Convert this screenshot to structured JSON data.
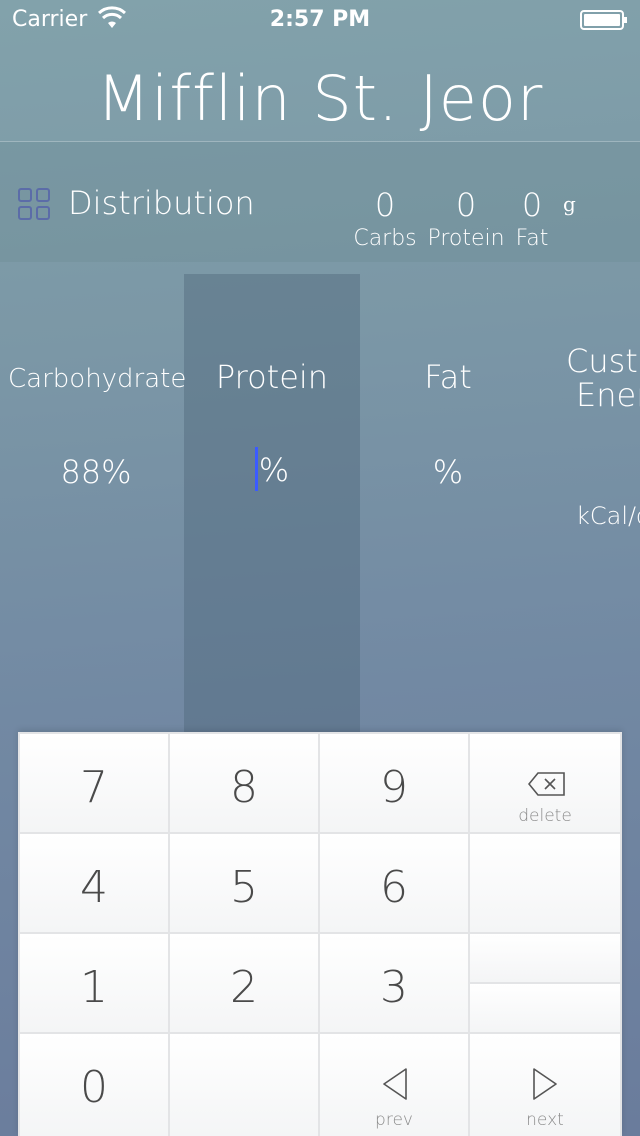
{
  "status_bar": {
    "carrier": "Carrier",
    "time": "2:57 PM"
  },
  "title": "Mifflin St. Jeor",
  "distribution": {
    "label": "Distribution",
    "icon": "grid-icon",
    "carbs_value": "0",
    "carbs_label": "Carbs",
    "protein_value": "0",
    "protein_label": "Protein",
    "fat_value": "0",
    "fat_label": "Fat",
    "unit": "g"
  },
  "columns": {
    "carbohydrate": {
      "title": "Carbohydrate",
      "value": "88%"
    },
    "protein": {
      "title": "Protein",
      "value": "%"
    },
    "fat": {
      "title": "Fat",
      "value": "%"
    },
    "custom_energy": {
      "title_line1": "Custo",
      "title_line2": "Ener",
      "value": "kCal/c"
    }
  },
  "keypad": {
    "keys": [
      "7",
      "8",
      "9",
      "4",
      "5",
      "6",
      "1",
      "2",
      "3",
      "0"
    ],
    "delete_label": "delete",
    "prev_label": "prev",
    "next_label": "next"
  },
  "colors": {
    "cursor": "#3b5bff",
    "accent_icon": "#5b6ca8"
  }
}
